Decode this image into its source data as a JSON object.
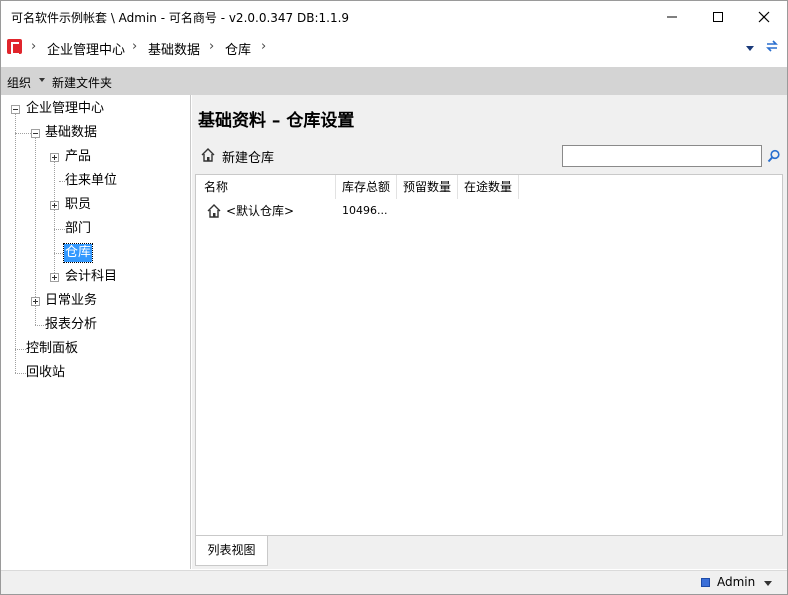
{
  "window": {
    "title": "可名软件示例帐套 \\ Admin - 可名商号 - v2.0.0.347  DB:1.1.9"
  },
  "breadcrumb": {
    "items": [
      "企业管理中心",
      "基础数据",
      "仓库"
    ],
    "separator": "›"
  },
  "toolbar": {
    "organize_label": "组织",
    "new_folder_label": "新建文件夹"
  },
  "tree": {
    "root": "企业管理中心",
    "basic_data": "基础数据",
    "product": "产品",
    "contacts": "往来单位",
    "staff": "职员",
    "department": "部门",
    "warehouse": "仓库",
    "accounts": "会计科目",
    "daily_business": "日常业务",
    "reports": "报表分析",
    "control_panel": "控制面板",
    "recycle_bin": "回收站"
  },
  "main": {
    "title": "基础资料  –  仓库设置",
    "new_warehouse_label": "新建仓库",
    "search_placeholder": "",
    "columns": [
      "名称",
      "库存总额",
      "预留数量",
      "在途数量"
    ],
    "rows": [
      {
        "name": "<默认仓库>",
        "stock_total": "10496...",
        "reserved": "",
        "in_transit": ""
      }
    ],
    "view_tab": "列表视图"
  },
  "status": {
    "user": "Admin"
  },
  "colors": {
    "selection": "#3399ff",
    "toolbar_bg": "#d4d4d4",
    "app_icon": "#e0252c"
  }
}
